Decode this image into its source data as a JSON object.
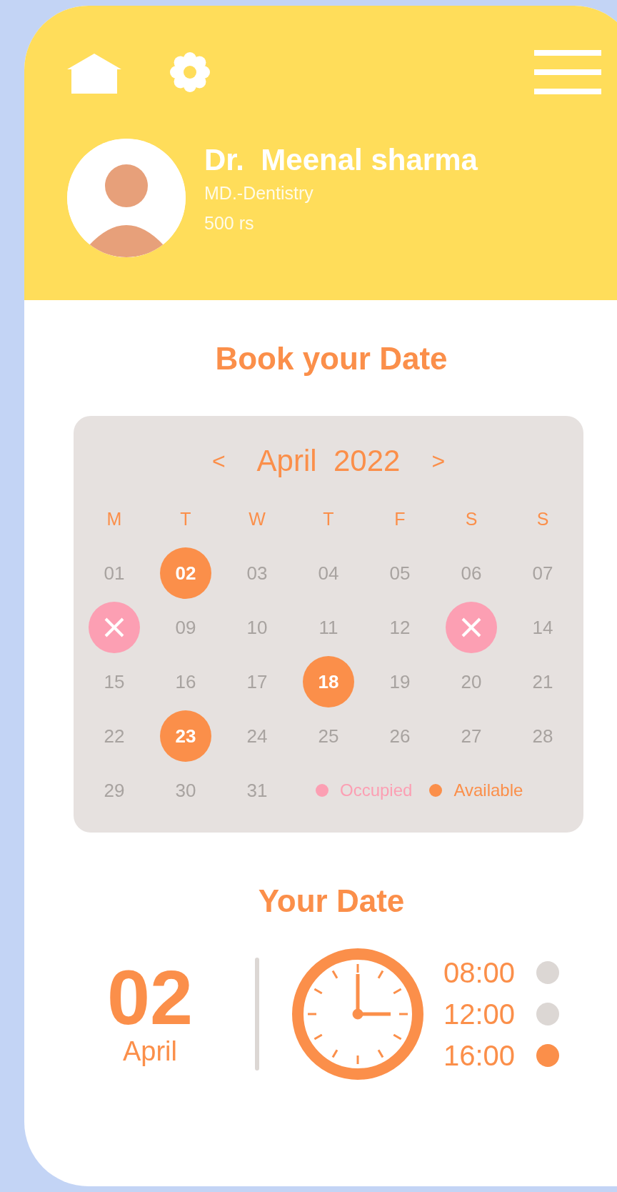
{
  "profile": {
    "name": "Dr.  Meenal sharma",
    "specialty": "MD.-Dentistry",
    "fee": "500 rs"
  },
  "booking": {
    "title": "Book your Date",
    "calendar": {
      "prev": "<",
      "month": "April  2022",
      "next": ">",
      "weekdays": [
        "M",
        "T",
        "W",
        "T",
        "F",
        "S",
        "S"
      ],
      "days": [
        {
          "label": "01",
          "kind": "normal"
        },
        {
          "label": "02",
          "kind": "available"
        },
        {
          "label": "03",
          "kind": "normal"
        },
        {
          "label": "04",
          "kind": "normal"
        },
        {
          "label": "05",
          "kind": "normal"
        },
        {
          "label": "06",
          "kind": "normal"
        },
        {
          "label": "07",
          "kind": "normal"
        },
        {
          "kind": "occupied"
        },
        {
          "label": "09",
          "kind": "normal"
        },
        {
          "label": "10",
          "kind": "normal"
        },
        {
          "label": "11",
          "kind": "normal"
        },
        {
          "label": "12",
          "kind": "normal"
        },
        {
          "kind": "occupied"
        },
        {
          "label": "14",
          "kind": "normal"
        },
        {
          "label": "15",
          "kind": "normal"
        },
        {
          "label": "16",
          "kind": "normal"
        },
        {
          "label": "17",
          "kind": "normal"
        },
        {
          "label": "18",
          "kind": "available"
        },
        {
          "label": "19",
          "kind": "normal"
        },
        {
          "label": "20",
          "kind": "normal"
        },
        {
          "label": "21",
          "kind": "normal"
        },
        {
          "label": "22",
          "kind": "normal"
        },
        {
          "label": "23",
          "kind": "available"
        },
        {
          "label": "24",
          "kind": "normal"
        },
        {
          "label": "25",
          "kind": "normal"
        },
        {
          "label": "26",
          "kind": "normal"
        },
        {
          "label": "27",
          "kind": "normal"
        },
        {
          "label": "28",
          "kind": "normal"
        },
        {
          "label": "29",
          "kind": "normal"
        },
        {
          "label": "30",
          "kind": "normal"
        },
        {
          "label": "31",
          "kind": "normal"
        }
      ],
      "legend": [
        {
          "label": "Occupied",
          "color": "#fc9fb3"
        },
        {
          "label": "Available",
          "color": "#fb8f4a"
        }
      ]
    }
  },
  "your_date": {
    "title": "Your Date",
    "day": "02",
    "month": "April",
    "times": [
      {
        "label": "08:00",
        "selected": false
      },
      {
        "label": "12:00",
        "selected": false
      },
      {
        "label": "16:00",
        "selected": true
      }
    ]
  }
}
